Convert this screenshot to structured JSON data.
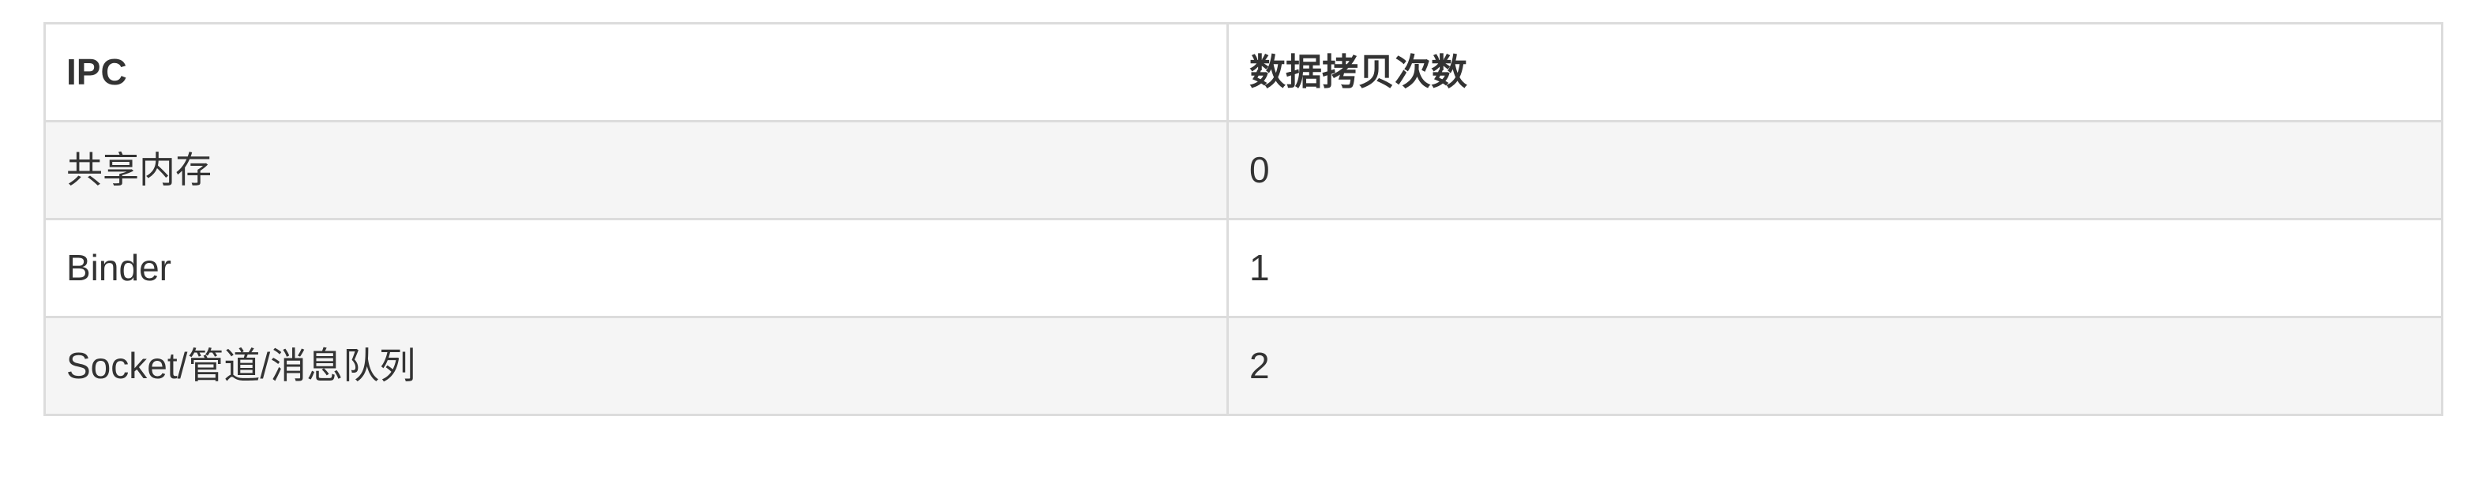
{
  "table": {
    "headers": [
      "IPC",
      "数据拷贝次数"
    ],
    "rows": [
      [
        "共享内存",
        "0"
      ],
      [
        "Binder",
        "1"
      ],
      [
        "Socket/管道/消息队列",
        "2"
      ]
    ]
  },
  "colors": {
    "header_bg": "#ffffff",
    "row_odd_bg": "#f5f5f5",
    "row_even_bg": "#ffffff",
    "border": "#dcdcdc",
    "text": "#333333"
  }
}
